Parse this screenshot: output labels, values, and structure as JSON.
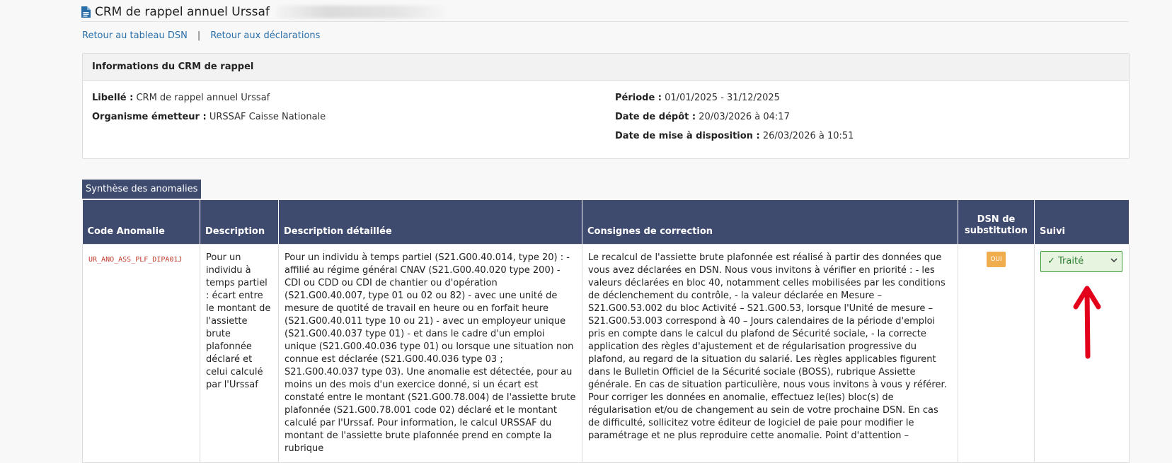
{
  "header": {
    "title": "CRM de rappel annuel Urssaf"
  },
  "nav": {
    "back_dsn": "Retour au tableau DSN",
    "separator": "|",
    "back_declarations": "Retour aux déclarations"
  },
  "info_panel": {
    "title": "Informations du CRM de rappel",
    "left": [
      {
        "label": "Libellé :",
        "value": "CRM de rappel annuel Urssaf"
      },
      {
        "label": "Organisme émetteur :",
        "value": "URSSAF Caisse Nationale"
      }
    ],
    "right": [
      {
        "label": "Période :",
        "value": "01/01/2025 - 31/12/2025"
      },
      {
        "label": "Date de dépôt :",
        "value": "20/03/2026 à 04:17"
      },
      {
        "label": "Date de mise à disposition :",
        "value": "26/03/2026 à 10:51"
      }
    ]
  },
  "synthesis": {
    "tab_label": "Synthèse des anomalies",
    "columns": {
      "code": "Code Anomalie",
      "description": "Description",
      "detail": "Description détaillée",
      "consignes": "Consignes de correction",
      "dsn_sub": "DSN de substitution",
      "suivi": "Suivi"
    },
    "rows": [
      {
        "code": "UR_ANO_ASS_PLF_DIPA01J",
        "description": "Pour un individu à temps partiel : écart entre le montant de l'assiette brute plafonnée déclaré et celui calculé par l'Urssaf",
        "detail": "Pour un individu à temps partiel (S21.G00.40.014, type 20) : - affilié au régime général CNAV (S21.G00.40.020 type 200) - CDI ou CDD ou CDI de chantier ou d'opération (S21.G00.40.007, type 01 ou 02 ou 82) - avec une unité de mesure de quotité de travail en heure ou en forfait heure (S21.G00.40.011 type 10 ou 21) - avec un employeur unique (S21.G00.40.037 type 01) - et dans le cadre d'un emploi unique (S21.G00.40.036 type 01) ou lorsque une situation non connue est déclarée (S21.G00.40.036 type 03 ; S21.G00.40.037 type 03). Une anomalie est détectée, pour au moins un des mois d'un exercice donné, si un écart est constaté entre le montant (S21.G00.78.004) de l'assiette brute plafonnée (S21.G00.78.001 code 02) déclaré et le montant calculé par l'Urssaf. Pour information, le calcul URSSAF du montant de l'assiette brute plafonnée prend en compte la rubrique",
        "consignes": "Le recalcul de l'assiette brute plafonnée est réalisé à partir des données que vous avez déclarées en DSN. Nous vous invitons à vérifier en priorité : - les valeurs déclarées en bloc 40, notamment celles mobilisées par les conditions de déclenchement du contrôle, - la valeur déclarée en Mesure – S21.G00.53.002 du bloc Activité – S21.G00.53, lorsque l'Unité de mesure – S21.G00.53.003 correspond à 40 – Jours calendaires de la période d'emploi pris en compte dans le calcul du plafond de Sécurité sociale, - la correcte application des règles d'ajustement et de régularisation progressive du plafond, au regard de la situation du salarié. Les règles applicables figurent dans le Bulletin Officiel de la Sécurité sociale (BOSS), rubrique Assiette générale. En cas de situation particulière, nous vous invitons à vous y référer. Pour corriger les données en anomalie, effectuez le(les) bloc(s) de régularisation et/ou de changement au sein de votre prochaine DSN. En cas de difficulté, sollicitez votre éditeur de logiciel de paie pour modifier le paramétrage et ne plus reproduire cette anomalie. Point d'attention –",
        "dsn_sub": "OUI",
        "suivi": "✓ Traité"
      }
    ]
  },
  "colors": {
    "header_bg": "#3e4a6e",
    "link": "#2a6fa8",
    "badge_oui": "#f0ad4e",
    "code_red": "#c0392b",
    "suivi_green": "#2e7d32",
    "arrow_red": "#e3001b"
  },
  "icons": {
    "title_icon": "document-icon",
    "select_chevron": "chevron-down-icon",
    "annotation": "red-arrow-up"
  }
}
